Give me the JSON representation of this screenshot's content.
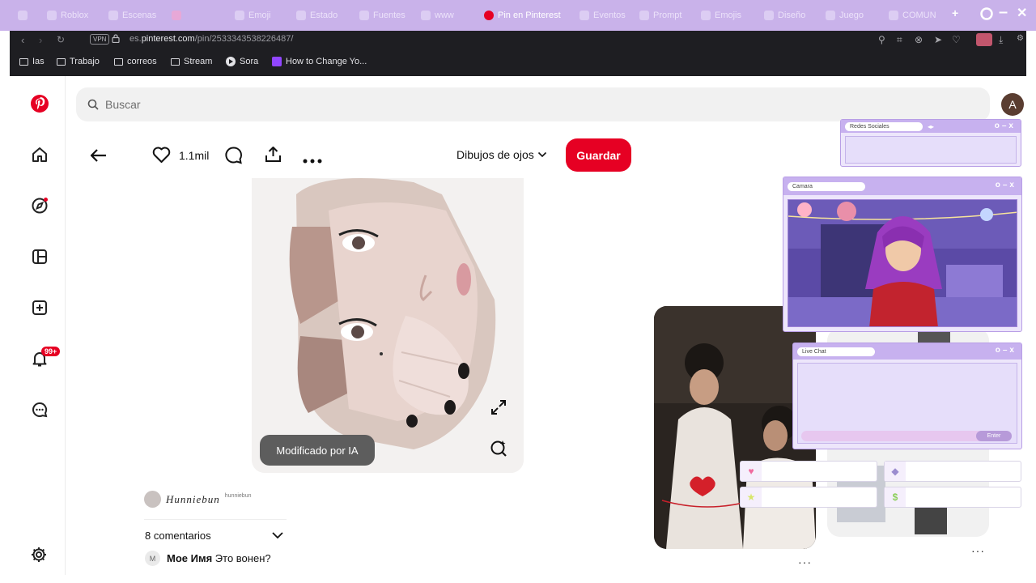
{
  "browser": {
    "tabs": [
      "",
      "Roblox",
      "Escenas",
      "",
      "Emoji",
      "Estado",
      "Fuentes",
      "www",
      "Pin en Pinterest",
      "Eventos",
      "Prompt",
      "Emojis",
      "Diseño",
      "Juego",
      "COMUN"
    ],
    "vpn_label": "VPN",
    "url_prefix": "es.",
    "url_domain": "pinterest.com",
    "url_path": "/pin/2533343538226487/",
    "bookmarks": [
      {
        "label": "Ias",
        "icon": "folder-icon"
      },
      {
        "label": "Trabajo",
        "icon": "folder-icon"
      },
      {
        "label": "correos",
        "icon": "folder-icon"
      },
      {
        "label": "Stream",
        "icon": "folder-icon"
      },
      {
        "label": "Sora",
        "icon": "play-icon"
      },
      {
        "label": "How to Change Yo...",
        "icon": "twitch-icon"
      }
    ]
  },
  "header": {
    "search_placeholder": "Buscar",
    "avatar_initial": "A"
  },
  "sidebar": {
    "notifications_badge": "99+"
  },
  "pin": {
    "like_count": "1.1mil",
    "board_name": "Dibujos de ojos",
    "save_label": "Guardar",
    "ai_badge": "Modificado por IA",
    "author_name": "Hunniebun",
    "author_handle": "hunniebun",
    "comments_label": "8 comentarios",
    "first_comment": {
      "avatar_initial": "M",
      "author": "Мое Имя",
      "text": "Это вонен?"
    }
  },
  "overlay": {
    "social_title": "Redes Sociales",
    "camera_title": "Camara",
    "chat_title": "Live Chat",
    "chat_enter": "Enter"
  },
  "colors": {
    "pinterest_red": "#e60023",
    "overlay_purple": "#c7b1ef",
    "chrome_dark": "#1e1e22"
  }
}
